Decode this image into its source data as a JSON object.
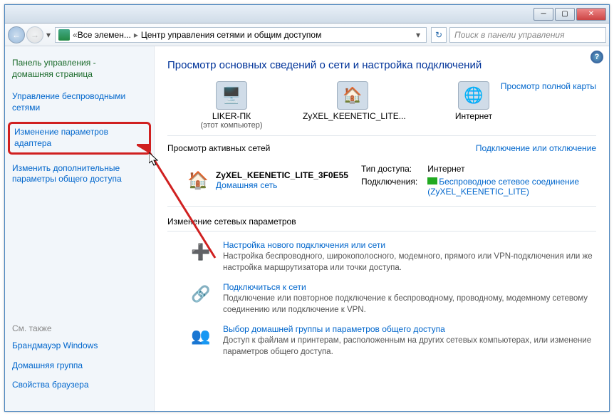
{
  "titlebar": {},
  "nav": {
    "bc_root": "Все элемен...",
    "bc_current": "Центр управления сетями и общим доступом",
    "search_placeholder": "Поиск в панели управления"
  },
  "sidebar": {
    "home1": "Панель управления -",
    "home2": "домашняя страница",
    "links": [
      "Управление беспроводными сетями",
      "Изменение параметров адаптера",
      "Изменить дополнительные параметры общего доступа"
    ],
    "seealso_title": "См. также",
    "seealso": [
      "Брандмауэр Windows",
      "Домашняя группа",
      "Свойства браузера"
    ]
  },
  "main": {
    "heading": "Просмотр основных сведений о сети и настройка подключений",
    "fullmap": "Просмотр полной карты",
    "net_pc_name": "LIKER-ПК",
    "net_pc_sub": "(этот компьютер)",
    "net_router": "ZyXEL_KEENETIC_LITE...",
    "net_internet": "Интернет",
    "active_title": "Просмотр активных сетей",
    "active_link": "Подключение или отключение",
    "conn_name": "ZyXEL_KEENETIC_LITE_3F0E55",
    "conn_type": "Домашняя сеть",
    "access_label": "Тип доступа:",
    "access_value": "Интернет",
    "connections_label": "Подключения:",
    "conn_link": "Беспроводное сетевое соединение (ZyXEL_KEENETIC_LITE)",
    "params_title": "Изменение сетевых параметров",
    "params": [
      {
        "title": "Настройка нового подключения или сети",
        "desc": "Настройка беспроводного, широкополосного, модемного, прямого или VPN-подключения или же настройка маршрутизатора или точки доступа."
      },
      {
        "title": "Подключиться к сети",
        "desc": "Подключение или повторное подключение к беспроводному, проводному, модемному сетевому соединению или подключение к VPN."
      },
      {
        "title": "Выбор домашней группы и параметров общего доступа",
        "desc": "Доступ к файлам и принтерам, расположенным на других сетевых компьютерах, или изменение параметров общего доступа."
      }
    ]
  }
}
